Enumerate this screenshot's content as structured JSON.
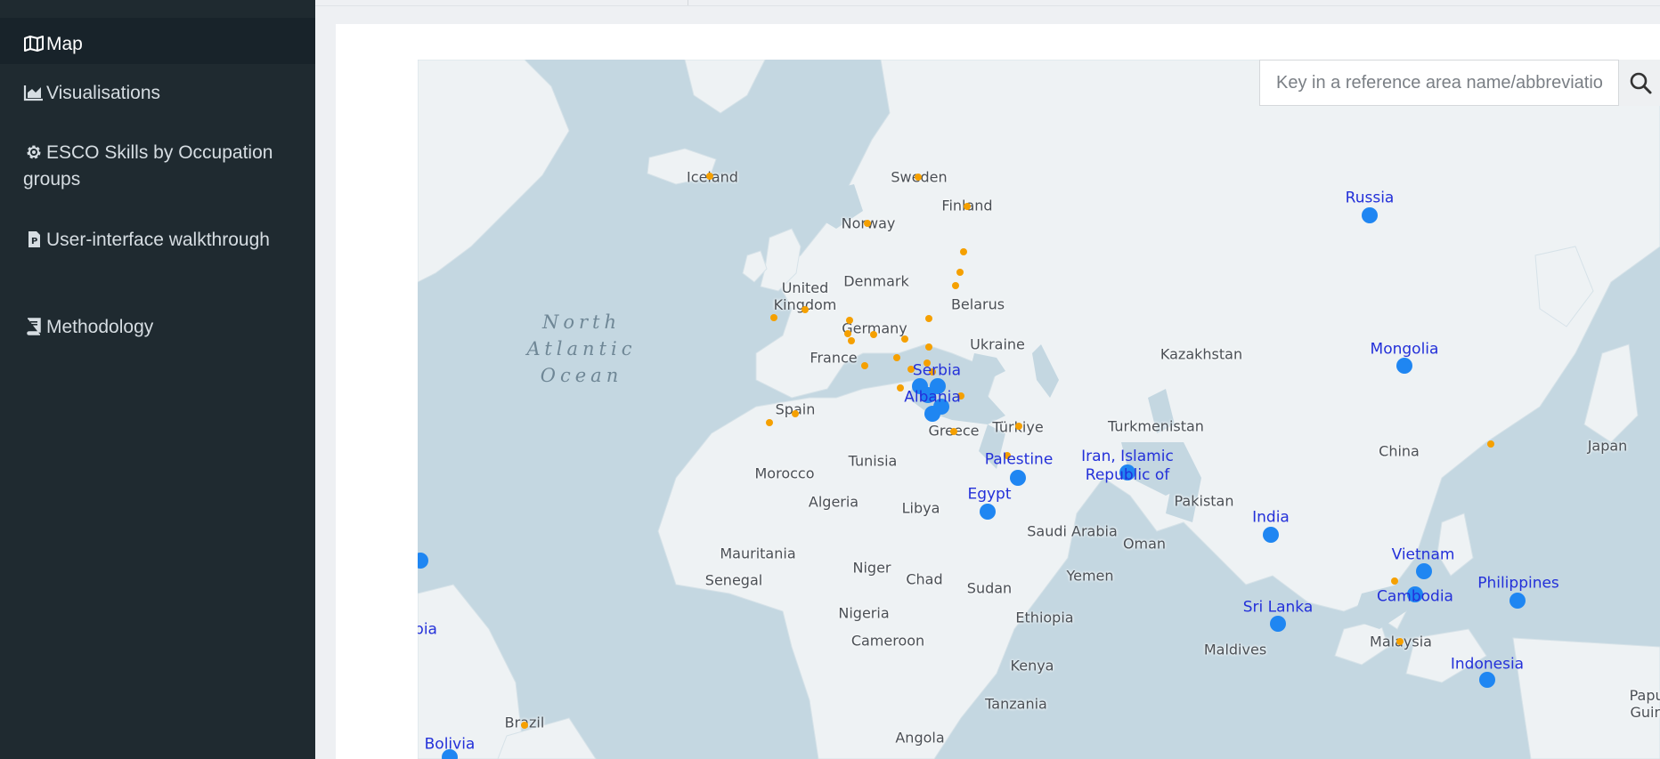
{
  "sidebar": {
    "items": [
      {
        "label": "Map",
        "icon": "map-icon",
        "active": true
      },
      {
        "label": "Visualisations",
        "icon": "area-chart-icon"
      },
      {
        "label": "ESCO Skills by Occupation groups",
        "icon": "gear-icon"
      },
      {
        "label": "User-interface walkthrough",
        "icon": "document-icon"
      },
      {
        "label": "Methodology",
        "icon": "book-icon"
      }
    ]
  },
  "search": {
    "placeholder": "Key in a reference area name/abbreviatio",
    "icon": "search-icon"
  },
  "map": {
    "ocean_label": "North\nAtlantic\nOcean",
    "country_labels": {
      "iceland": "Iceland",
      "sweden": "Sweden",
      "finland": "Finland",
      "norway": "Norway",
      "denmark": "Denmark",
      "united_kingdom": "United\nKingdom",
      "belarus": "Belarus",
      "germany": "Germany",
      "ukraine": "Ukraine",
      "france": "France",
      "kazakhstan": "Kazakhstan",
      "spain": "Spain",
      "turkiye": "Türkiye",
      "turkmenistan": "Turkmenistan",
      "greece": "Greece",
      "morocco": "Morocco",
      "tunisia": "Tunisia",
      "china": "China",
      "japan": "Japan",
      "algeria": "Algeria",
      "libya": "Libya",
      "pakistan": "Pakistan",
      "saudi_arabia": "Saudi Arabia",
      "oman": "Oman",
      "mauritania": "Mauritania",
      "niger": "Niger",
      "senegal": "Senegal",
      "chad": "Chad",
      "yemen": "Yemen",
      "sudan": "Sudan",
      "nigeria": "Nigeria",
      "ethiopia": "Ethiopia",
      "cameroon": "Cameroon",
      "maldives": "Maldives",
      "malaysia": "Malaysia",
      "kenya": "Kenya",
      "tanzania": "Tanzania",
      "brazil": "Brazil",
      "angola": "Angola",
      "papua": "Papua\nGuine"
    },
    "highlighted_labels": {
      "russia": "Russia",
      "mongolia": "Mongolia",
      "serbia": "Serbia",
      "albania": "Albania",
      "palestine": "Palestine",
      "iran": "Iran, Islamic\nRepublic of",
      "egypt": "Egypt",
      "india": "India",
      "vietnam": "Vietnam",
      "cambodia": "Cambodia",
      "philippines": "Philippines",
      "sri_lanka": "Sri Lanka",
      "indonesia": "Indonesia",
      "bolivia": "Bolivia",
      "colombia": "bia"
    },
    "colors": {
      "water": "#c4d7e1",
      "land": "#eef2f4",
      "highlight_marker": "#1f86f2",
      "minor_marker": "#f5a000",
      "highlight_label": "#2330d9"
    }
  }
}
